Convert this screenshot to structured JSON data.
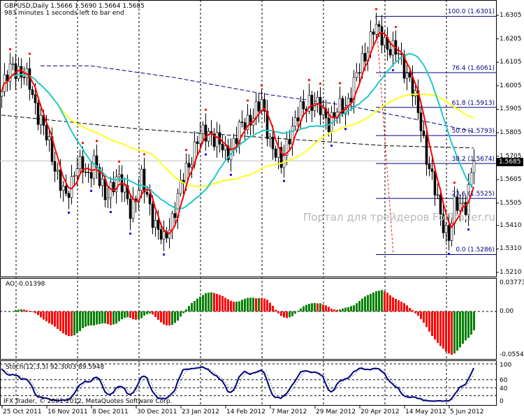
{
  "header": {
    "line1": "GBPUSD,Daily  1.5666 1.5690 1.5664 1.5685",
    "line2": "983 minutes 1 seconds left to bar end"
  },
  "watermark": "Портал для трейдеров ForTrader.ru",
  "current_price": "1.5685",
  "ao_label": "AO -0.01398",
  "stoch_label": "Stoch(12,3,3) 92.3003 89.5948",
  "copyright": "IFX Trader, © 2001-2012, MetaQuotes Software Corp.",
  "colors": {
    "bull": "#008000",
    "bear": "#ff0000",
    "ma_fast": "#ff0000",
    "ma_mid": "#20c8c8",
    "ma_slow": "#ffff20",
    "fib": "#000080",
    "stoch": "#000080"
  },
  "chart_data": [
    {
      "type": "candlestick",
      "title": "GBPUSD,Daily",
      "price_ticks": [
        "1.6305",
        "1.6205",
        "1.6105",
        "1.6005",
        "1.5905",
        "1.5805",
        "1.5705",
        "1.5605",
        "1.5505",
        "1.5410",
        "1.5310",
        "1.5210"
      ],
      "price_tick_values": [
        1.6305,
        1.6205,
        1.6105,
        1.6005,
        1.5905,
        1.5805,
        1.5705,
        1.5605,
        1.5505,
        1.541,
        1.531,
        1.521
      ],
      "ylim": [
        1.5195,
        1.6365
      ],
      "bar_count": 170,
      "close_keypoints": [
        [
          0,
          1.598
        ],
        [
          4,
          1.61
        ],
        [
          10,
          1.601
        ],
        [
          13,
          1.589
        ],
        [
          18,
          1.571
        ],
        [
          23,
          1.551
        ],
        [
          27,
          1.569
        ],
        [
          31,
          1.56
        ],
        [
          33,
          1.571
        ],
        [
          37,
          1.551
        ],
        [
          41,
          1.563
        ],
        [
          46,
          1.548
        ],
        [
          50,
          1.56
        ],
        [
          55,
          1.542
        ],
        [
          58,
          1.533
        ],
        [
          61,
          1.545
        ],
        [
          64,
          1.557
        ],
        [
          70,
          1.578
        ],
        [
          75,
          1.581
        ],
        [
          80,
          1.571
        ],
        [
          85,
          1.581
        ],
        [
          90,
          1.589
        ],
        [
          93,
          1.592
        ],
        [
          96,
          1.578
        ],
        [
          100,
          1.566
        ],
        [
          103,
          1.581
        ],
        [
          110,
          1.595
        ],
        [
          117,
          1.586
        ],
        [
          123,
          1.592
        ],
        [
          128,
          1.607
        ],
        [
          133,
          1.625
        ],
        [
          136,
          1.621
        ],
        [
          142,
          1.613
        ],
        [
          146,
          1.604
        ],
        [
          150,
          1.583
        ],
        [
          153,
          1.566
        ],
        [
          157,
          1.545
        ],
        [
          160,
          1.537
        ],
        [
          162,
          1.548
        ],
        [
          166,
          1.551
        ],
        [
          169,
          1.5685
        ]
      ],
      "blue_dashed_ma": [
        [
          14,
          1.609
        ],
        [
          32,
          1.609
        ],
        [
          62,
          1.604
        ],
        [
          94,
          1.597
        ],
        [
          124,
          1.592
        ],
        [
          149,
          1.586
        ],
        [
          169,
          1.581
        ]
      ],
      "black_dashed_ma": [
        [
          0,
          1.588
        ],
        [
          50,
          1.582
        ],
        [
          100,
          1.578
        ],
        [
          137,
          1.575
        ],
        [
          169,
          1.574
        ]
      ],
      "fibonacci": {
        "start_bar": 134,
        "levels": [
          {
            "label": "100.0 (1.6301)",
            "value": 1.6301
          },
          {
            "label": "76.4 (1.6061)",
            "value": 1.6061
          },
          {
            "label": "61.8 (1.5913)",
            "value": 1.5913
          },
          {
            "label": "50.0 (1.5793)",
            "value": 1.5793
          },
          {
            "label": "38.2 (1.5674)",
            "value": 1.5674
          },
          {
            "label": "23.6 (1.5525)",
            "value": 1.5525
          },
          {
            "label": "0.0 (1.5286)",
            "value": 1.5286
          }
        ]
      },
      "dates": [
        "25 Oct 2011",
        "16 Nov 2011",
        "8 Dec 2011",
        "30 Dec 2011",
        "23 Jan 2012",
        "14 Feb 2012",
        "7 Mar 2012",
        "29 Mar 2012",
        "20 Apr 2012",
        "14 May 2012",
        "5 Jun 2012"
      ]
    },
    {
      "type": "bar",
      "title": "AO",
      "ticks": [
        "0.03773",
        "0.00",
        "-0.0554"
      ],
      "ylim": [
        -0.0554,
        0.03773
      ]
    },
    {
      "type": "line",
      "title": "Stoch(12,3,3)",
      "ticks": [
        "100",
        "60",
        "40",
        "0"
      ],
      "levels": [
        100,
        60,
        40,
        20
      ],
      "ylim": [
        0,
        100
      ]
    }
  ]
}
